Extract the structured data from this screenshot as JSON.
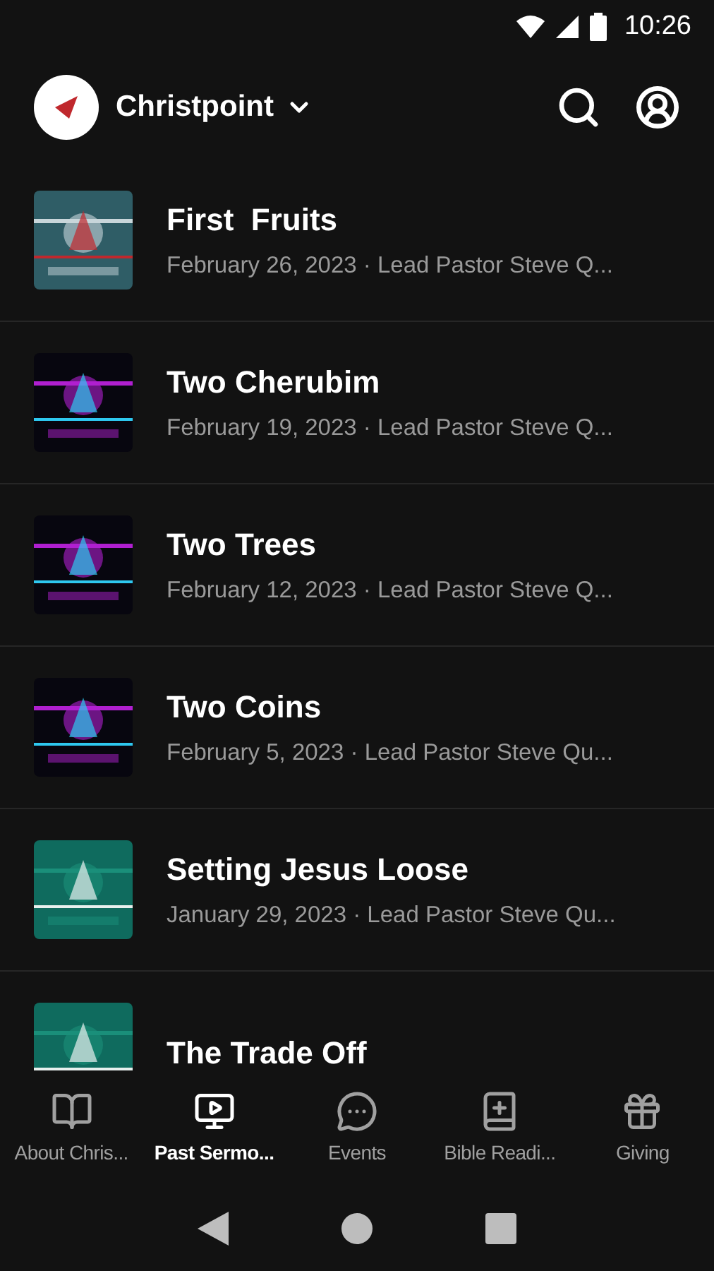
{
  "status_bar": {
    "time": "10:26"
  },
  "header": {
    "title": "Christpoint"
  },
  "sermons": [
    {
      "title": "First  Fruits",
      "subtitle": "February 26, 2023 · Lead Pastor Steve Q..."
    },
    {
      "title": "Two Cherubim",
      "subtitle": "February 19, 2023 · Lead Pastor Steve Q..."
    },
    {
      "title": "Two Trees",
      "subtitle": "February 12, 2023 · Lead Pastor Steve Q..."
    },
    {
      "title": "Two Coins",
      "subtitle": "February 5, 2023 · Lead Pastor Steve Qu..."
    },
    {
      "title": "Setting Jesus Loose",
      "subtitle": "January 29, 2023 · Lead Pastor Steve Qu..."
    },
    {
      "title": "The Trade Off"
    }
  ],
  "tabs": [
    {
      "label": "About Chris...",
      "kind": "book",
      "selected": false
    },
    {
      "label": "Past Sermo...",
      "kind": "video",
      "selected": true
    },
    {
      "label": "Events",
      "kind": "chat",
      "selected": false
    },
    {
      "label": "Bible Readi...",
      "kind": "bible",
      "selected": false
    },
    {
      "label": "Giving",
      "kind": "gift",
      "selected": false
    }
  ]
}
